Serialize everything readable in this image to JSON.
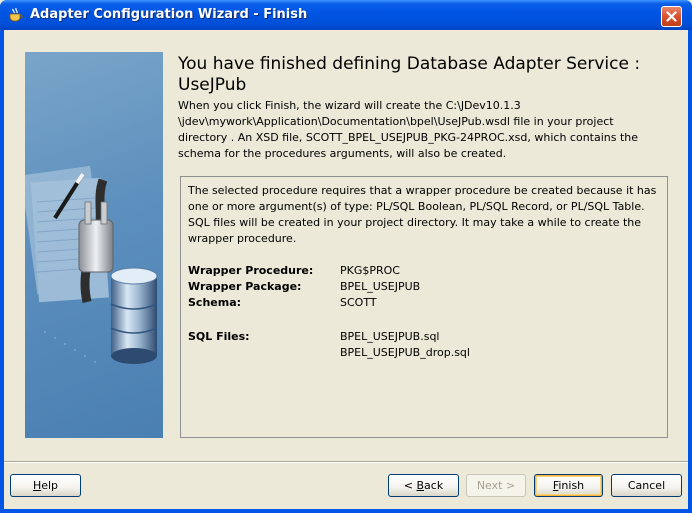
{
  "window": {
    "title": "Adapter Configuration Wizard - Finish",
    "icon": "java-cup-icon",
    "close_icon": "close-icon"
  },
  "art": {
    "description_icon": "database-plug-icon"
  },
  "header": {
    "heading": "You have finished defining Database Adapter Service : UseJPub",
    "intro": "When you click Finish, the wizard will create the C:\\JDev10.1.3 \\jdev\\mywork\\Application\\Documentation\\bpel\\UseJPub.wsdl file in your project directory . An XSD file, SCOTT_BPEL_USEJPUB_PKG-24PROC.xsd, which contains the schema for the procedures arguments, will also be created."
  },
  "details": {
    "text": "The selected procedure requires that a wrapper procedure be created because it has one or more argument(s) of type: PL/SQL Boolean, PL/SQL Record, or PL/SQL Table.  SQL files will be created in your project directory.  It may take a while to create the wrapper procedure.",
    "rows": [
      {
        "label": "Wrapper Procedure:",
        "value": "PKG$PROC"
      },
      {
        "label": "Wrapper Package:",
        "value": "BPEL_USEJPUB"
      },
      {
        "label": "Schema:",
        "value": "SCOTT"
      }
    ],
    "sql_files_label": "SQL Files:",
    "sql_files": [
      "BPEL_USEJPUB.sql",
      "BPEL_USEJPUB_drop.sql"
    ]
  },
  "buttons": {
    "help": {
      "mnemonic": "H",
      "rest": "elp"
    },
    "back": {
      "prefix": "< ",
      "mnemonic": "B",
      "rest": "ack"
    },
    "next": {
      "label": "Next >"
    },
    "finish": {
      "mnemonic": "F",
      "rest": "inish"
    },
    "cancel": {
      "label": "Cancel"
    }
  }
}
